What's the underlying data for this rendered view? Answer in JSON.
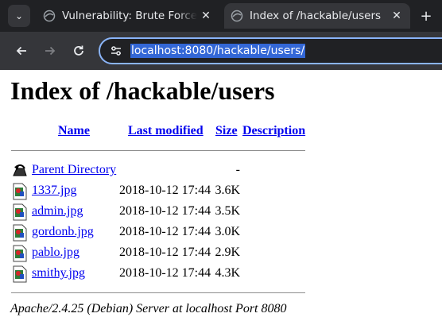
{
  "browser": {
    "tabs": [
      {
        "title": "Vulnerability: Brute Force",
        "active": false
      },
      {
        "title": "Index of /hackable/users",
        "active": true
      }
    ],
    "close_glyph": "✕",
    "new_tab_glyph": "+",
    "menu_glyph": "⌄",
    "url": "localhost:8080/hackable/users/",
    "colors": {
      "chrome_bg": "#202124",
      "toolbar_bg": "#35363a",
      "url_highlight": "#3367d6",
      "omnibox_border": "#8ab4f8"
    }
  },
  "page": {
    "heading": "Index of /hackable/users",
    "columns": {
      "name": "Name",
      "last_modified": "Last modified",
      "size": "Size",
      "description": "Description"
    },
    "parent": {
      "name": "Parent Directory",
      "last_modified": "",
      "size": "-",
      "icon": "back-icon"
    },
    "files": [
      {
        "name": "1337.jpg",
        "last_modified": "2018-10-12 17:44",
        "size": "3.6K",
        "icon": "image-icon"
      },
      {
        "name": "admin.jpg",
        "last_modified": "2018-10-12 17:44",
        "size": "3.5K",
        "icon": "image-icon"
      },
      {
        "name": "gordonb.jpg",
        "last_modified": "2018-10-12 17:44",
        "size": "3.0K",
        "icon": "image-icon"
      },
      {
        "name": "pablo.jpg",
        "last_modified": "2018-10-12 17:44",
        "size": "2.9K",
        "icon": "image-icon"
      },
      {
        "name": "smithy.jpg",
        "last_modified": "2018-10-12 17:44",
        "size": "4.3K",
        "icon": "image-icon"
      }
    ],
    "footer": "Apache/2.4.25 (Debian) Server at localhost Port 8080",
    "colors": {
      "link": "#0000ee",
      "rule": "#8d8d8d"
    }
  }
}
